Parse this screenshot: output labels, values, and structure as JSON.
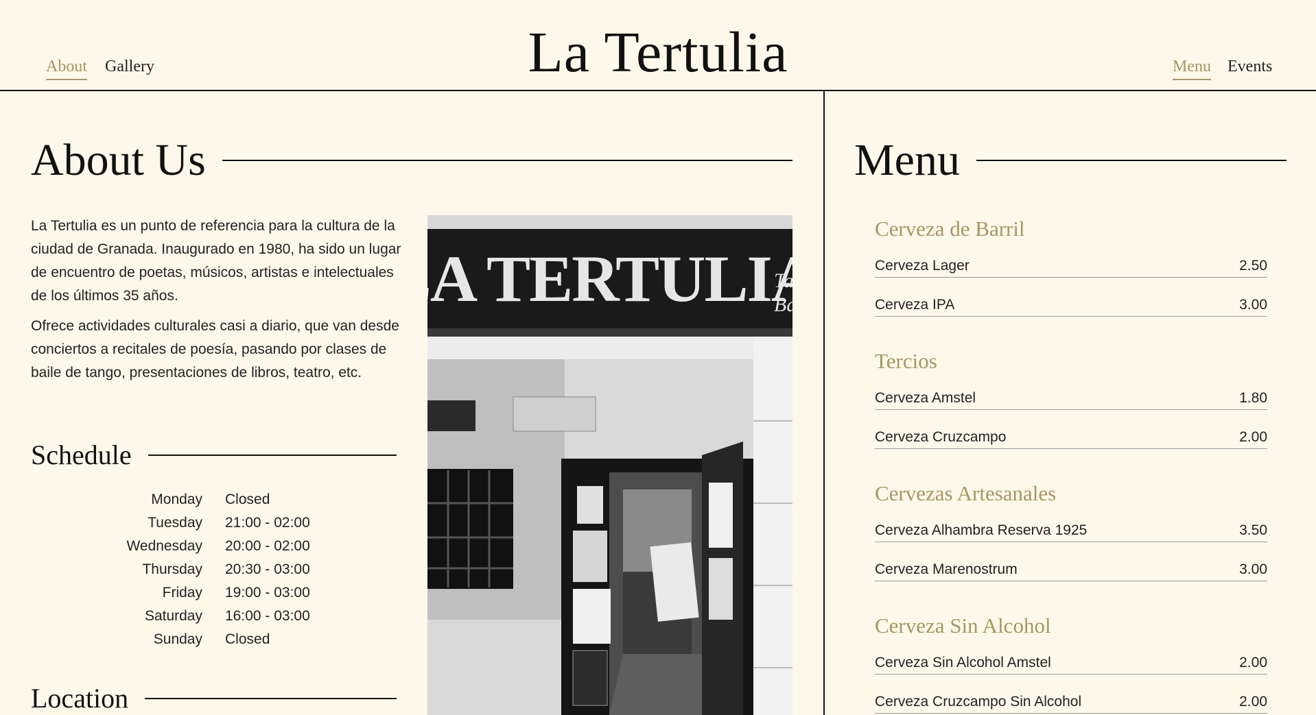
{
  "header": {
    "title": "La Tertulia",
    "nav_left": [
      "About",
      "Gallery"
    ],
    "nav_right": [
      "Menu",
      "Events"
    ]
  },
  "about": {
    "title": "About Us",
    "paragraphs": [
      "La Tertulia es un punto de referencia para la cultura de la ciudad de Granada. Inaugurado en 1980, ha sido un lugar de encuentro de poetas, músicos, artistas e intelectuales de los últimos 35 años.",
      "Ofrece actividades culturales casi a diario, que van desde conciertos a recitales de poesía, pasando por clases de baile de tango, presentaciones de libros, teatro, etc."
    ]
  },
  "schedule": {
    "title": "Schedule",
    "rows": [
      {
        "day": "Monday",
        "time": "Closed"
      },
      {
        "day": "Tuesday",
        "time": "21:00 - 02:00"
      },
      {
        "day": "Wednesday",
        "time": "20:00 - 02:00"
      },
      {
        "day": "Thursday",
        "time": "20:30 - 03:00"
      },
      {
        "day": "Friday",
        "time": "19:00 - 03:00"
      },
      {
        "day": "Saturday",
        "time": "16:00 - 03:00"
      },
      {
        "day": "Sunday",
        "time": "Closed"
      }
    ]
  },
  "location": {
    "title": "Location"
  },
  "photo": {
    "sign_text": "LA TERTULIA",
    "sign_sub": [
      "Tang",
      "Bar"
    ]
  },
  "menu": {
    "title": "Menu",
    "categories": [
      {
        "name": "Cerveza de Barril",
        "items": [
          {
            "name": "Cerveza Lager",
            "price": "2.50"
          },
          {
            "name": "Cerveza IPA",
            "price": "3.00"
          }
        ]
      },
      {
        "name": "Tercios",
        "items": [
          {
            "name": "Cerveza Amstel",
            "price": "1.80"
          },
          {
            "name": "Cerveza Cruzcampo",
            "price": "2.00"
          }
        ]
      },
      {
        "name": "Cervezas Artesanales",
        "items": [
          {
            "name": "Cerveza Alhambra Reserva 1925",
            "price": "3.50"
          },
          {
            "name": "Cerveza Marenostrum",
            "price": "3.00"
          }
        ]
      },
      {
        "name": "Cerveza Sin Alcohol",
        "items": [
          {
            "name": "Cerveza Sin Alcohol Amstel",
            "price": "2.00"
          },
          {
            "name": "Cerveza Cruzcampo Sin Alcohol",
            "price": "2.00"
          }
        ]
      }
    ]
  },
  "colors": {
    "background": "#fdf8ea",
    "accent": "#a89660",
    "text": "#1c1c1c"
  }
}
